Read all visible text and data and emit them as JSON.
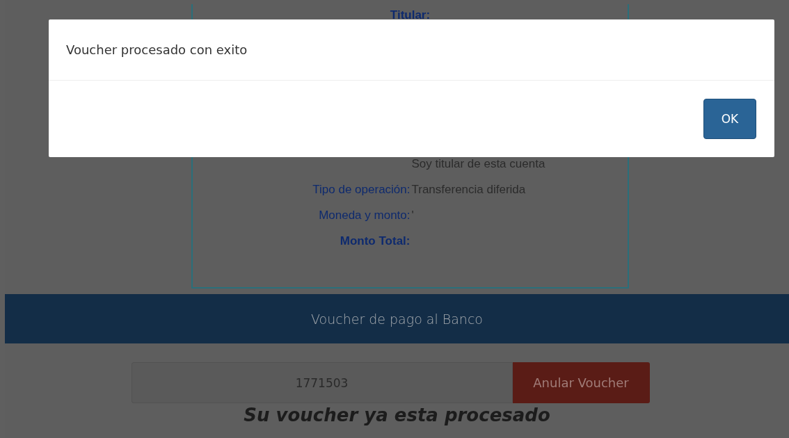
{
  "voucher_card": {
    "title_label": "Titular:",
    "rows": [
      {
        "label": "",
        "value": "Soy titular de esta cuenta",
        "strong": false
      },
      {
        "label": "Tipo de operación:",
        "value": "Transferencia diferida",
        "strong": false
      },
      {
        "label": "Moneda y monto:",
        "value": "'",
        "strong": false
      },
      {
        "label": "Monto Total:",
        "value": "",
        "strong": true
      }
    ]
  },
  "section_bar": {
    "title": "Voucher de pago al Banco"
  },
  "voucher_form": {
    "value": "1771503",
    "button": "Anular Voucher",
    "status": "Su voucher ya esta procesado"
  },
  "dialog": {
    "message": "Voucher procesado con exito",
    "button": "OK"
  }
}
